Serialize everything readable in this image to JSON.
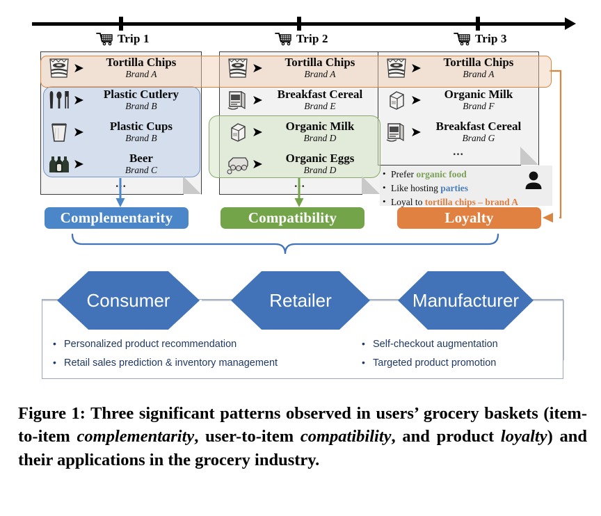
{
  "timeline": {
    "trips": [
      {
        "label": "Trip 1",
        "icon": "shopping-cart-icon"
      },
      {
        "label": "Trip 2",
        "icon": "shopping-cart-icon"
      },
      {
        "label": "Trip 3",
        "icon": "shopping-cart-icon"
      }
    ]
  },
  "baskets": [
    {
      "trip": "Trip 1",
      "items": [
        {
          "name": "Tortilla Chips",
          "brand": "Brand A",
          "icon": "chips-bag-icon"
        },
        {
          "name": "Plastic Cutlery",
          "brand": "Brand B",
          "icon": "cutlery-icon"
        },
        {
          "name": "Plastic Cups",
          "brand": "Brand B",
          "icon": "cup-icon"
        },
        {
          "name": "Beer",
          "brand": "Brand C",
          "icon": "beer-bottles-icon"
        }
      ],
      "more": "..."
    },
    {
      "trip": "Trip 2",
      "items": [
        {
          "name": "Tortilla Chips",
          "brand": "Brand A",
          "icon": "chips-bag-icon"
        },
        {
          "name": "Breakfast Cereal",
          "brand": "Brand E",
          "icon": "cereal-box-icon"
        },
        {
          "name": "Organic Milk",
          "brand": "Brand D",
          "icon": "milk-carton-icon"
        },
        {
          "name": "Organic Eggs",
          "brand": "Brand D",
          "icon": "egg-carton-icon"
        }
      ],
      "more": "..."
    },
    {
      "trip": "Trip 3",
      "items": [
        {
          "name": "Tortilla Chips",
          "brand": "Brand A",
          "icon": "chips-bag-icon"
        },
        {
          "name": "Organic Milk",
          "brand": "Brand F",
          "icon": "milk-carton-icon"
        },
        {
          "name": "Breakfast Cereal",
          "brand": "Brand G",
          "icon": "cereal-box-icon"
        }
      ],
      "more": "..."
    }
  ],
  "persona": {
    "icon": "person-icon",
    "bullets": [
      {
        "prefix": "Prefer ",
        "keyword": "organic food",
        "keyword_color": "#7aa055",
        "suffix": ""
      },
      {
        "prefix": "Like hosting ",
        "keyword": "parties",
        "keyword_color": "#4a7ebb",
        "suffix": ""
      },
      {
        "prefix": "Loyal to ",
        "keyword": "tortilla chips – brand A",
        "keyword_color": "#dd7e3f",
        "suffix": ""
      }
    ]
  },
  "patterns": [
    {
      "label": "Complementarity",
      "color": "#4a86c8"
    },
    {
      "label": "Compatibility",
      "color": "#74a44a"
    },
    {
      "label": "Loyalty",
      "color": "#e08142"
    }
  ],
  "applications": {
    "hexagons": [
      {
        "label": "Consumer"
      },
      {
        "label": "Retailer"
      },
      {
        "label": "Manufacturer"
      }
    ],
    "hex_color": "#4272b8",
    "columns": [
      {
        "bullets": [
          "Personalized product recommendation",
          "Retail sales prediction & inventory management"
        ]
      },
      {
        "bullets": [
          "Self-checkout augmentation",
          "Targeted product promotion"
        ]
      }
    ]
  },
  "caption": {
    "prefix": "Figure 1: Three significant patterns observed in users’ grocery baskets (item-to-item ",
    "em1": "complementarity",
    "mid1": ", user-to-item ",
    "em2": "compatibility",
    "mid2": ", and product ",
    "em3": "loyalty",
    "suffix": ") and their applications in the grocery industry."
  }
}
